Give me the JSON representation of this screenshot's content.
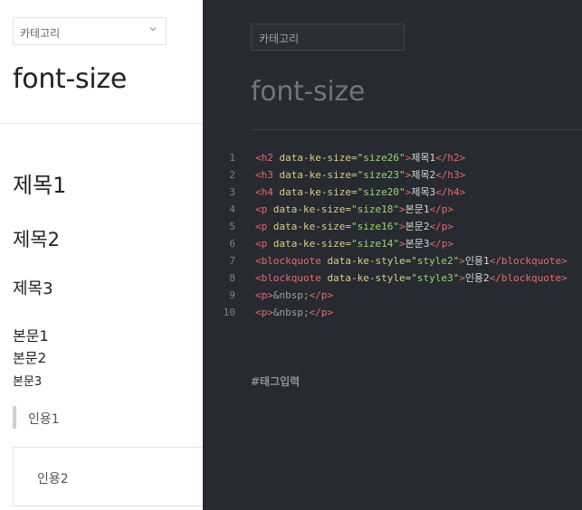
{
  "preview": {
    "category_select": "카테고리",
    "title": "font-size",
    "heading1": "제목1",
    "heading2": "제목2",
    "heading3": "제목3",
    "body1": "본문1",
    "body2": "본문2",
    "body3": "본문3",
    "quote1": "인용1",
    "quote2": "인용2"
  },
  "editor": {
    "category_select": "카테고리",
    "title": "font-size",
    "tag_input_label": "#태그입력",
    "lines": [
      {
        "num": "1",
        "parts": [
          [
            "tg",
            "<h2 "
          ],
          [
            "at",
            "data-ke-size="
          ],
          [
            "vl",
            "\"size26\""
          ],
          [
            "tg",
            ">"
          ],
          [
            "tx",
            "제목1"
          ],
          [
            "tg",
            "</h2>"
          ]
        ]
      },
      {
        "num": "2",
        "parts": [
          [
            "tg",
            "<h3 "
          ],
          [
            "at",
            "data-ke-size="
          ],
          [
            "vl",
            "\"size23\""
          ],
          [
            "tg",
            ">"
          ],
          [
            "tx",
            "제목2"
          ],
          [
            "tg",
            "</h3>"
          ]
        ]
      },
      {
        "num": "3",
        "parts": [
          [
            "tg",
            "<h4 "
          ],
          [
            "at",
            "data-ke-size="
          ],
          [
            "vl",
            "\"size20\""
          ],
          [
            "tg",
            ">"
          ],
          [
            "tx",
            "제목3"
          ],
          [
            "tg",
            "</h4>"
          ]
        ]
      },
      {
        "num": "4",
        "parts": [
          [
            "tg",
            "<p "
          ],
          [
            "at",
            "data-ke-size="
          ],
          [
            "vl",
            "\"size18\""
          ],
          [
            "tg",
            ">"
          ],
          [
            "tx",
            "본문1"
          ],
          [
            "tg",
            "</p>"
          ]
        ]
      },
      {
        "num": "5",
        "parts": [
          [
            "tg",
            "<p "
          ],
          [
            "at",
            "data-ke-size="
          ],
          [
            "vl",
            "\"size16\""
          ],
          [
            "tg",
            ">"
          ],
          [
            "tx",
            "본문2"
          ],
          [
            "tg",
            "</p>"
          ]
        ]
      },
      {
        "num": "6",
        "parts": [
          [
            "tg",
            "<p "
          ],
          [
            "at",
            "data-ke-size="
          ],
          [
            "vl",
            "\"size14\""
          ],
          [
            "tg",
            ">"
          ],
          [
            "tx",
            "본문3"
          ],
          [
            "tg",
            "</p>"
          ]
        ]
      },
      {
        "num": "7",
        "parts": [
          [
            "tg",
            "<blockquote "
          ],
          [
            "at",
            "data-ke-style="
          ],
          [
            "vl",
            "\"style2\""
          ],
          [
            "tg",
            ">"
          ],
          [
            "tx",
            "인용1"
          ],
          [
            "tg",
            "</blockquote>"
          ]
        ]
      },
      {
        "num": "8",
        "parts": [
          [
            "tg",
            "<blockquote "
          ],
          [
            "at",
            "data-ke-style="
          ],
          [
            "vl",
            "\"style3\""
          ],
          [
            "tg",
            ">"
          ],
          [
            "tx",
            "인용2"
          ],
          [
            "tg",
            "</blockquote>"
          ]
        ]
      },
      {
        "num": "9",
        "parts": [
          [
            "tg",
            "<p>"
          ],
          [
            "en",
            "&nbsp;"
          ],
          [
            "tg",
            "</p>"
          ]
        ]
      },
      {
        "num": "10",
        "parts": [
          [
            "tg",
            "<p>"
          ],
          [
            "en",
            "&nbsp;"
          ],
          [
            "tg",
            "</p>"
          ]
        ]
      }
    ]
  }
}
